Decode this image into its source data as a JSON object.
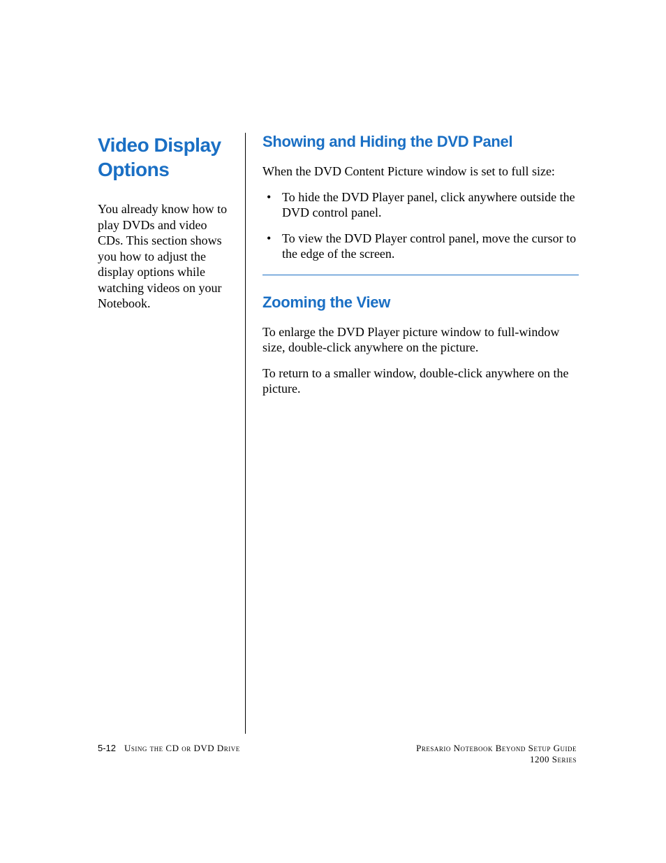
{
  "sidebar": {
    "title": "Video Display Options",
    "intro": "You already know how to play DVDs and video CDs. This section shows you how to adjust the display options while watching videos on your Notebook."
  },
  "sections": [
    {
      "heading": "Showing and Hiding the DVD Panel",
      "intro": "When the DVD Content Picture window is set to full size:",
      "bullets": [
        "To hide the DVD Player panel, click anywhere outside the DVD control panel.",
        "To view the DVD Player control panel, move the cursor to the edge of the screen."
      ]
    },
    {
      "heading": "Zooming the View",
      "paragraphs": [
        "To enlarge the DVD Player picture window to full-window size, double-click anywhere on the picture.",
        "To return to a smaller window, double-click anywhere on the picture."
      ]
    }
  ],
  "footer": {
    "page_number": "5-12",
    "left_label": "Using the CD or DVD Drive",
    "right_line1": "Presario Notebook Beyond Setup Guide",
    "right_line2": "1200 Series"
  }
}
